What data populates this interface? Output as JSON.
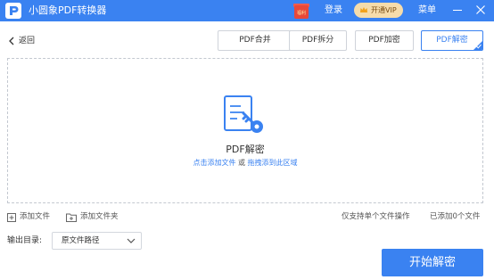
{
  "titlebar": {
    "app_title": "小圆象PDF转换器",
    "gift_label": "福利",
    "login_label": "登录",
    "vip_label": "开通VIP",
    "menu_label": "菜单"
  },
  "toolbar": {
    "back_label": "返回",
    "tabs": [
      {
        "label": "PDF合并",
        "active": false
      },
      {
        "label": "PDF拆分",
        "active": false
      },
      {
        "label": "PDF加密",
        "active": false
      },
      {
        "label": "PDF解密",
        "active": true
      }
    ]
  },
  "dropzone": {
    "title": "PDF解密",
    "hint_click": "点击添加文件",
    "hint_or": " 或 ",
    "hint_drag": "拖拽添到此区域"
  },
  "footer": {
    "add_file_label": "添加文件",
    "add_folder_label": "添加文件夹",
    "single_file_note": "仅支持单个文件操作",
    "added_count": "已添加0个文件",
    "output_dir_label": "输出目录:",
    "output_dir_value": "原文件路径",
    "start_button_label": "开始解密"
  },
  "colors": {
    "accent": "#3a82f1",
    "vip_bg": "#f6dcab",
    "gift_red": "#e8483a"
  },
  "icons": {
    "logo": "app-logo-icon",
    "gift": "gift-icon",
    "crown": "crown-icon",
    "back": "chevron-left-icon",
    "file_key": "file-key-icon",
    "add_file": "add-file-icon",
    "add_folder": "add-folder-icon",
    "dropdown": "chevron-down-icon"
  }
}
